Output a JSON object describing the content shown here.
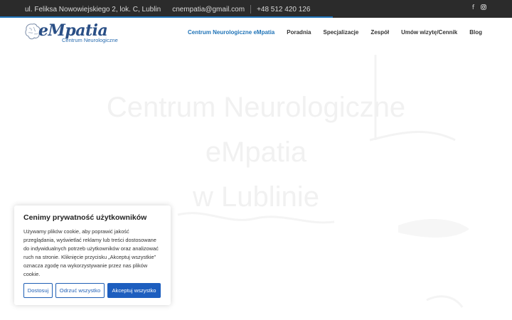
{
  "topbar": {
    "address": "ul. Feliksa Nowowiejskiego 2, lok. C, Lublin",
    "email": "cnempatia@gmail.com",
    "phone": "+48 512 420 126",
    "social_icons": [
      "facebook-icon",
      "instagram-icon"
    ]
  },
  "logo": {
    "brand": "eMpatia",
    "subtitle": "Centrum Neurologiczne"
  },
  "nav": {
    "items": [
      {
        "label": "Centrum Neurologiczne eMpatia",
        "active": true
      },
      {
        "label": "Poradnia",
        "active": false
      },
      {
        "label": "Specjalizacje",
        "active": false
      },
      {
        "label": "Zespół",
        "active": false
      },
      {
        "label": "Umów wizytę/Cennik",
        "active": false
      },
      {
        "label": "Blog",
        "active": false
      }
    ]
  },
  "hero": {
    "line1": "Centrum Neurologiczne",
    "line2": "eMpatia",
    "line3": "w Lublinie"
  },
  "cookie": {
    "title": "Cenimy prywatność użytkowników",
    "body": "Używamy plików cookie, aby poprawić jakość przeglądania, wyświetlać reklamy lub treści dostosowane do indywidualnych potrzeb użytkowników oraz analizować ruch na stronie. Kliknięcie przycisku „Akceptuj wszystkie” oznacza zgodę na wykorzystywanie przez nas plików cookie.",
    "customize_label": "Dostosuj",
    "reject_label": "Odrzuć wszystko",
    "accept_label": "Akceptuj wszystko"
  },
  "colors": {
    "accent": "#1f73b7",
    "topbar_bg": "#2b2b2b",
    "button_primary": "#1d5ebf"
  }
}
